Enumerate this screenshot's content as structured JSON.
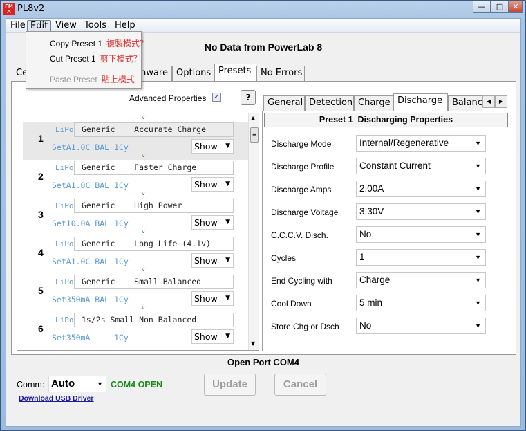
{
  "window": {
    "title": "PL8v2",
    "icon": "fma-logo",
    "controls": [
      "minimize",
      "maximize",
      "close"
    ]
  },
  "menubar": {
    "items": [
      "File",
      "Edit",
      "View",
      "Tools",
      "Help"
    ],
    "open": "Edit"
  },
  "edit_menu": {
    "items": [
      {
        "label": "Copy Preset 1",
        "note": "複製模式？",
        "enabled": true
      },
      {
        "label": "Cut Preset 1",
        "note": "剪下模式？",
        "enabled": true
      },
      {
        "label": "Paste Preset",
        "note": "貼上模式",
        "enabled": false
      }
    ]
  },
  "header": {
    "title": "No Data from PowerLab 8"
  },
  "main_tabs": [
    "Ce",
    "",
    "mware",
    "Options",
    "Presets",
    "No Errors"
  ],
  "main_tab_selected": "Presets",
  "advanced": {
    "label": "Advanced Properties",
    "checked": true,
    "help": "?"
  },
  "presets": [
    {
      "num": "1",
      "chem": "LiPo",
      "name": "Generic    Accurate Charge",
      "settings": "SetA1.0C BAL 1Cy",
      "show": "Show",
      "v": "v"
    },
    {
      "num": "2",
      "chem": "LiPo",
      "name": "Generic    Faster Charge",
      "settings": "SetA1.0C BAL 1Cy",
      "show": "Show",
      "v": "v"
    },
    {
      "num": "3",
      "chem": "LiPo",
      "name": "Generic    High Power",
      "settings": "Set10.0A BAL 1Cy",
      "show": "Show",
      "v": "v"
    },
    {
      "num": "4",
      "chem": "LiPo",
      "name": "Generic    Long Life (4.1v)",
      "settings": "SetA1.0C BAL 1Cy",
      "show": "Show",
      "v": "v"
    },
    {
      "num": "5",
      "chem": "LiPo",
      "name": "Generic    Small Balanced",
      "settings": "Set350mA BAL 1Cy",
      "show": "Show",
      "v": "v"
    },
    {
      "num": "6",
      "chem": "LiPo",
      "name": "1s/2s Small Non Balanced",
      "settings": "Set350mA     1Cy",
      "show": "Show",
      "v": "v"
    }
  ],
  "sub_tabs": [
    "General",
    "Detection",
    "Charge",
    "Discharge",
    "Balanc"
  ],
  "sub_tab_selected": "Discharge",
  "discharge": {
    "header": "Preset 1  Discharging Properties",
    "rows": [
      {
        "label": "Discharge Mode",
        "value": "Internal/Regenerative"
      },
      {
        "label": "Discharge Profile",
        "value": "Constant Current"
      },
      {
        "label": "Discharge Amps",
        "value": "2.00A"
      },
      {
        "label": "Discharge Voltage",
        "value": "3.30V"
      },
      {
        "label": "C.C.C.V. Disch.",
        "value": "No"
      },
      {
        "label": "Cycles",
        "value": "1"
      },
      {
        "label": "End Cycling with",
        "value": "Charge"
      },
      {
        "label": "Cool Down",
        "value": "5 min"
      },
      {
        "label": "Store Chg or Dsch",
        "value": "No"
      }
    ]
  },
  "footer": {
    "status": "Open Port COM4",
    "comm_label": "Comm:",
    "comm_value": "Auto",
    "comm_status": "COM4 OPEN",
    "update": "Update",
    "cancel": "Cancel",
    "usb_link": "Download USB Driver"
  },
  "colors": {
    "accent_green": "#1a8a1a",
    "link": "#1a1aa0",
    "preset_blue": "#5b9bd5",
    "menu_note_red": "#e03030"
  }
}
